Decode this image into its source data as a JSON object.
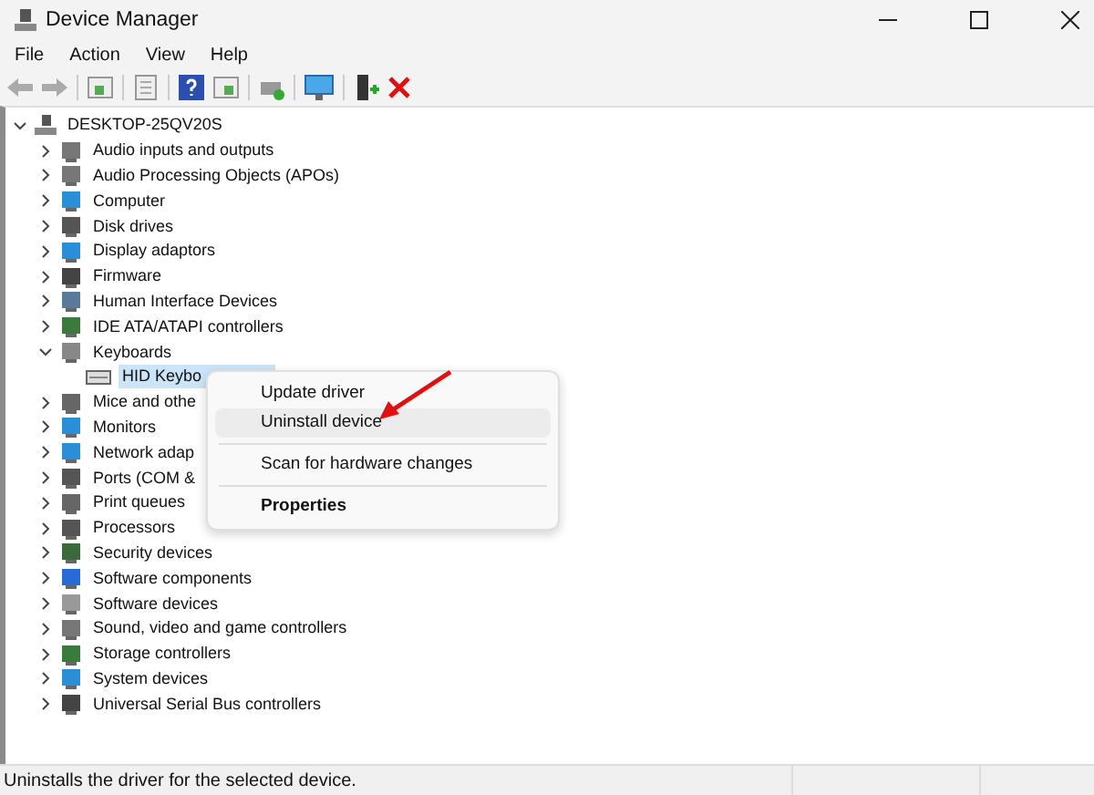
{
  "window": {
    "title": "Device Manager"
  },
  "menu": [
    "File",
    "Action",
    "View",
    "Help"
  ],
  "tree": {
    "label": "DESKTOP-25QV20S",
    "expanded": true,
    "children": [
      {
        "label": "Audio inputs and outputs",
        "expanded": false
      },
      {
        "label": "Audio Processing Objects (APOs)",
        "expanded": false
      },
      {
        "label": "Computer",
        "expanded": false
      },
      {
        "label": "Disk drives",
        "expanded": false
      },
      {
        "label": "Display adaptors",
        "expanded": false
      },
      {
        "label": "Firmware",
        "expanded": false
      },
      {
        "label": "Human Interface Devices",
        "expanded": false
      },
      {
        "label": "IDE ATA/ATAPI controllers",
        "expanded": false
      },
      {
        "label": "Keyboards",
        "expanded": true,
        "children": [
          {
            "label": "HID Keybo",
            "selected": true
          }
        ]
      },
      {
        "label": "Mice and othe",
        "expanded": false
      },
      {
        "label": "Monitors",
        "expanded": false
      },
      {
        "label": "Network adap",
        "expanded": false
      },
      {
        "label": "Ports (COM &",
        "expanded": false
      },
      {
        "label": "Print queues",
        "expanded": false
      },
      {
        "label": "Processors",
        "expanded": false
      },
      {
        "label": "Security devices",
        "expanded": false
      },
      {
        "label": "Software components",
        "expanded": false
      },
      {
        "label": "Software devices",
        "expanded": false
      },
      {
        "label": "Sound, video and game controllers",
        "expanded": false
      },
      {
        "label": "Storage controllers",
        "expanded": false
      },
      {
        "label": "System devices",
        "expanded": false
      },
      {
        "label": "Universal Serial Bus controllers",
        "expanded": false
      }
    ]
  },
  "context_menu": [
    {
      "kind": "item",
      "label": "Update driver",
      "selected": false
    },
    {
      "kind": "item",
      "label": "Uninstall device",
      "selected": true
    },
    {
      "kind": "separator"
    },
    {
      "kind": "item",
      "label": "Scan for hardware changes",
      "selected": false
    },
    {
      "kind": "separator"
    },
    {
      "kind": "default",
      "label": "Properties",
      "selected": false
    }
  ],
  "status_bar": "Uninstalls the driver for the selected device."
}
